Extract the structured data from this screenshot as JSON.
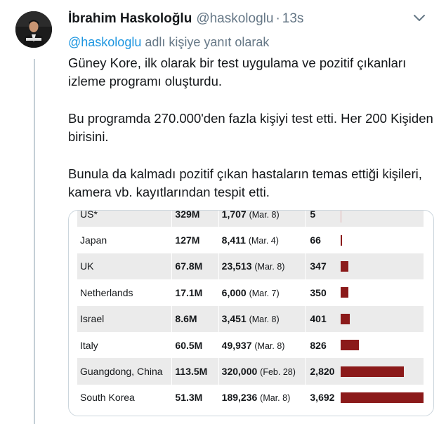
{
  "tweet": {
    "display_name": "İbrahim Haskoloğlu",
    "handle": "@haskologlu",
    "separator": "·",
    "time": "13s",
    "reply_prefix": "@haskologlu",
    "reply_suffix": " adlı kişiye yanıt olarak",
    "paragraphs": [
      "Güney Kore, ilk olarak bir test uygulama ve pozitif çıkanları izleme programı oluşturdu.",
      "Bu programda 270.000'den fazla kişiyi test etti. Her 200 Kişiden birisini.",
      "Bunula da kalmadı pozitif çıkan hastaların temas ettiği kişileri, kamera vb. kayıtlarından tespit etti."
    ],
    "icons": {
      "avatar": "profile-photo",
      "menu": "chevron-down-icon"
    },
    "colors": {
      "link": "#1b95e0",
      "muted": "#657786",
      "bar": "#8b1a1a"
    }
  },
  "table": {
    "rows": [
      {
        "country": "US*",
        "population": "329M",
        "tests": "1,707",
        "date": "(Mar. 8)",
        "per_million": "5",
        "per_million_value": 5
      },
      {
        "country": "Japan",
        "population": "127M",
        "tests": "8,411",
        "date": "(Mar. 4)",
        "per_million": "66",
        "per_million_value": 66
      },
      {
        "country": "UK",
        "population": "67.8M",
        "tests": "23,513",
        "date": "(Mar. 8)",
        "per_million": "347",
        "per_million_value": 347
      },
      {
        "country": "Netherlands",
        "population": "17.1M",
        "tests": "6,000",
        "date": "(Mar. 7)",
        "per_million": "350",
        "per_million_value": 350
      },
      {
        "country": "Israel",
        "population": "8.6M",
        "tests": "3,451",
        "date": "(Mar. 8)",
        "per_million": "401",
        "per_million_value": 401
      },
      {
        "country": "Italy",
        "population": "60.5M",
        "tests": "49,937",
        "date": "(Mar. 8)",
        "per_million": "826",
        "per_million_value": 826
      },
      {
        "country": "Guangdong, China",
        "population": "113.5M",
        "tests": "320,000",
        "date": "(Feb. 28)",
        "per_million": "2,820",
        "per_million_value": 2820
      },
      {
        "country": "South Korea",
        "population": "51.3M",
        "tests": "189,236",
        "date": "(Mar. 8)",
        "per_million": "3,692",
        "per_million_value": 3692
      }
    ],
    "bar_max": 3692
  }
}
